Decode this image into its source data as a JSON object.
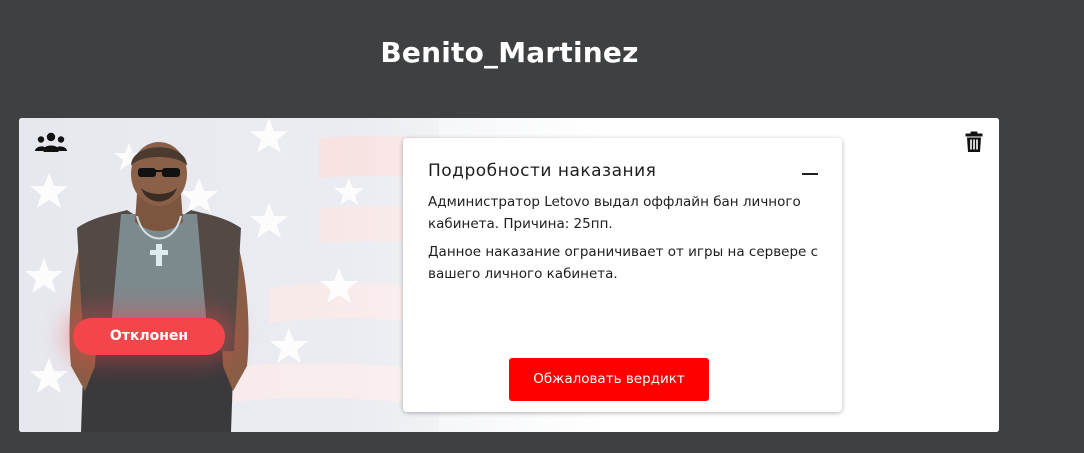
{
  "header": {
    "username": "Benito_Martinez"
  },
  "card": {
    "users_icon": "users-group-icon",
    "delete_icon": "trash-icon",
    "status_label": "Отклонен",
    "status_color": "#f4454b"
  },
  "details": {
    "title": "Подробности наказания",
    "collapse_icon": "minus-icon",
    "paragraph_1": "Администратор Letovo выдал оффлайн бан личного кабинета. Причина: 25пп.",
    "paragraph_2": "Данное наказание ограничивает от игры на сервере с вашего личного кабинета.",
    "appeal_button_label": "Обжаловать вердикт",
    "appeal_button_color": "#ff0000"
  }
}
